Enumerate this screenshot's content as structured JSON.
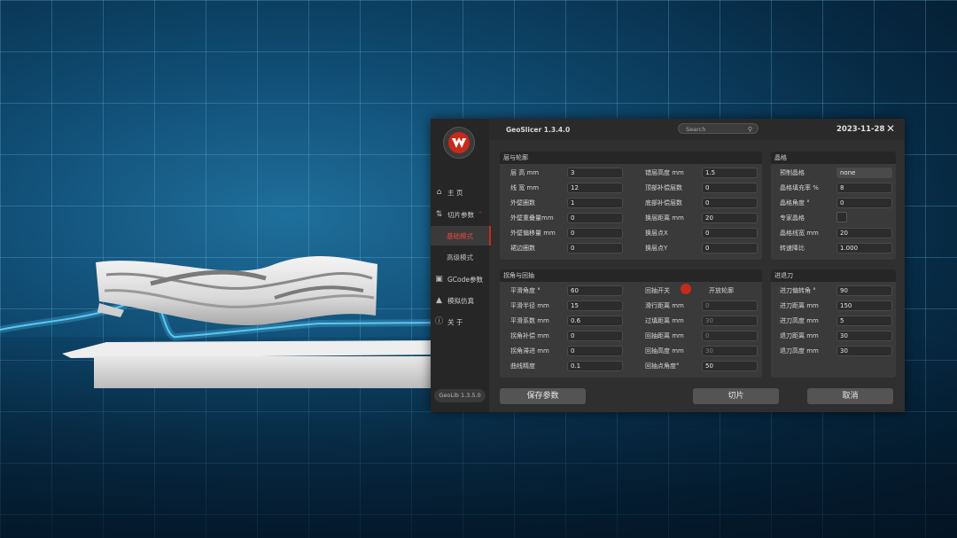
{
  "app": {
    "title": "GeoSlicer 1.3.4.0",
    "date": "2023-11-28",
    "version": "GeoLib 1.3.5.0"
  },
  "search": {
    "placeholder": "Search"
  },
  "sidebar": {
    "items": [
      {
        "label": "主 页",
        "icon": "home-icon"
      },
      {
        "label": "切片参数",
        "icon": "slider-icon"
      },
      {
        "label": "基础模式",
        "active": true
      },
      {
        "label": "高级模式"
      },
      {
        "label": "GCode参数",
        "icon": "gcode-icon"
      },
      {
        "label": "模拟仿真",
        "icon": "simulate-icon"
      },
      {
        "label": "关 于",
        "icon": "about-icon"
      }
    ]
  },
  "colors": {
    "accent": "#c62a1a",
    "dialog": "#2f2f2f",
    "panel": "#3a3a3a"
  },
  "panels": {
    "layer": {
      "title": "层与轮廓",
      "left": [
        {
          "label": "层 高 mm",
          "value": "3"
        },
        {
          "label": "线 宽 mm",
          "value": "12"
        },
        {
          "label": "外壁圈数",
          "value": "1"
        },
        {
          "label": "外壁重叠量mm",
          "value": "0"
        },
        {
          "label": "外壁偏移量 mm",
          "value": "0"
        },
        {
          "label": "裙边圈数",
          "value": "0"
        }
      ],
      "right": [
        {
          "label": "错层高度 mm",
          "value": "1.5"
        },
        {
          "label": "顶部补偿层数",
          "value": "0"
        },
        {
          "label": "底部补偿层数",
          "value": "0"
        },
        {
          "label": "换层距离 mm",
          "value": "20"
        },
        {
          "label": "换层点X",
          "value": "0"
        },
        {
          "label": "换层点Y",
          "value": "0"
        }
      ]
    },
    "grid": {
      "title": "晶格",
      "rows": [
        {
          "label": "预制晶格",
          "value": "none"
        },
        {
          "label": "晶格填充率 %",
          "value": "8"
        },
        {
          "label": "晶格角度 °",
          "value": "0"
        },
        {
          "label": "专家晶格",
          "value": ""
        },
        {
          "label": "晶格线宽 mm",
          "value": "20"
        },
        {
          "label": "转速降比",
          "value": "1.000"
        }
      ]
    },
    "corner": {
      "title": "拐角与回抽",
      "left": [
        {
          "label": "平滑角度 °",
          "value": "60"
        },
        {
          "label": "平滑半径 mm",
          "value": "15"
        },
        {
          "label": "平滑系数 mm",
          "value": "0.6"
        },
        {
          "label": "拐角补偿 mm",
          "value": "0"
        },
        {
          "label": "拐角滞进 mm",
          "value": "0"
        },
        {
          "label": "曲线精度",
          "value": "0.1"
        }
      ],
      "right_switch": {
        "label": "回抽开关",
        "switch_label": "开放轮廓"
      },
      "right": [
        {
          "label": "滑行距离 mm",
          "value": "0"
        },
        {
          "label": "过填距离 mm",
          "value": "30"
        },
        {
          "label": "回抽距离 mm",
          "value": "0"
        },
        {
          "label": "回抽高度 mm",
          "value": "30"
        },
        {
          "label": "回抽点角度°",
          "value": "50"
        }
      ]
    },
    "tool": {
      "title": "进退刀",
      "rows": [
        {
          "label": "进刀偏转角 °",
          "value": "90"
        },
        {
          "label": "进刀距离 mm",
          "value": "150"
        },
        {
          "label": "进刀高度 mm",
          "value": "5"
        },
        {
          "label": "退刀距离 mm",
          "value": "30"
        },
        {
          "label": "退刀高度 mm",
          "value": "30"
        }
      ]
    }
  },
  "buttons": {
    "save": "保存参数",
    "slice": "切片",
    "cancel": "取消"
  }
}
